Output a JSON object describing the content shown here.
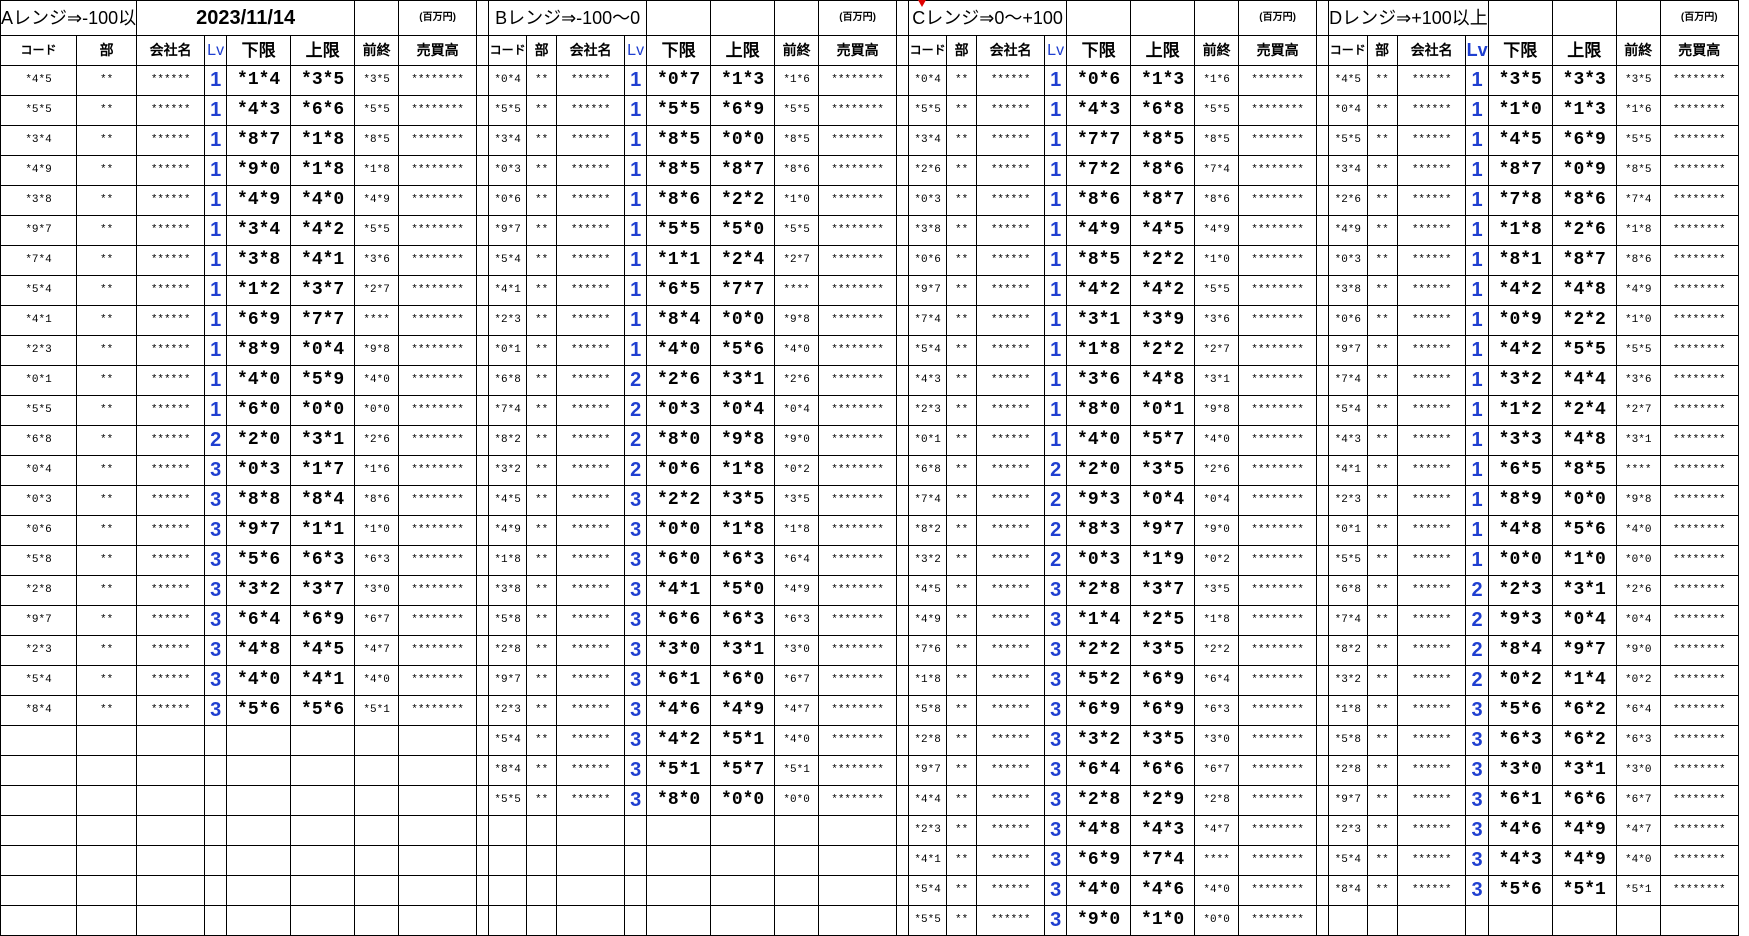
{
  "header": {
    "date": "2023/11/14",
    "unit": "(百万円)"
  },
  "columns": {
    "code": "コード",
    "bu": "部",
    "name": "会社名",
    "lv": "Lv",
    "lo": "下限",
    "hi": "上限",
    "prev": "前終",
    "sales": "売買高"
  },
  "blocks": [
    {
      "title": "Aレンジ⇒-100以",
      "rows": [
        [
          "*4*5",
          "**",
          "******",
          "1",
          "*1*4",
          "*3*5",
          "*3*5",
          "********"
        ],
        [
          "*5*5",
          "**",
          "******",
          "1",
          "*4*3",
          "*6*6",
          "*5*5",
          "********"
        ],
        [
          "*3*4",
          "**",
          "******",
          "1",
          "*8*7",
          "*1*8",
          "*8*5",
          "********"
        ],
        [
          "*4*9",
          "**",
          "******",
          "1",
          "*9*0",
          "*1*8",
          "*1*8",
          "********"
        ],
        [
          "*3*8",
          "**",
          "******",
          "1",
          "*4*9",
          "*4*0",
          "*4*9",
          "********"
        ],
        [
          "*9*7",
          "**",
          "******",
          "1",
          "*3*4",
          "*4*2",
          "*5*5",
          "********"
        ],
        [
          "*7*4",
          "**",
          "******",
          "1",
          "*3*8",
          "*4*1",
          "*3*6",
          "********"
        ],
        [
          "*5*4",
          "**",
          "******",
          "1",
          "*1*2",
          "*3*7",
          "*2*7",
          "********"
        ],
        [
          "*4*1",
          "**",
          "******",
          "1",
          "*6*9",
          "*7*7",
          "****",
          "********"
        ],
        [
          "*2*3",
          "**",
          "******",
          "1",
          "*8*9",
          "*0*4",
          "*9*8",
          "********"
        ],
        [
          "*0*1",
          "**",
          "******",
          "1",
          "*4*0",
          "*5*9",
          "*4*0",
          "********"
        ],
        [
          "*5*5",
          "**",
          "******",
          "1",
          "*6*0",
          "*0*0",
          "*0*0",
          "********"
        ],
        [
          "*6*8",
          "**",
          "******",
          "2",
          "*2*0",
          "*3*1",
          "*2*6",
          "********"
        ],
        [
          "*0*4",
          "**",
          "******",
          "3",
          "*0*3",
          "*1*7",
          "*1*6",
          "********"
        ],
        [
          "*0*3",
          "**",
          "******",
          "3",
          "*8*8",
          "*8*4",
          "*8*6",
          "********"
        ],
        [
          "*0*6",
          "**",
          "******",
          "3",
          "*9*7",
          "*1*1",
          "*1*0",
          "********"
        ],
        [
          "*5*8",
          "**",
          "******",
          "3",
          "*5*6",
          "*6*3",
          "*6*3",
          "********"
        ],
        [
          "*2*8",
          "**",
          "******",
          "3",
          "*3*2",
          "*3*7",
          "*3*0",
          "********"
        ],
        [
          "*9*7",
          "**",
          "******",
          "3",
          "*6*4",
          "*6*9",
          "*6*7",
          "********"
        ],
        [
          "*2*3",
          "**",
          "******",
          "3",
          "*4*8",
          "*4*5",
          "*4*7",
          "********"
        ],
        [
          "*5*4",
          "**",
          "******",
          "3",
          "*4*0",
          "*4*1",
          "*4*0",
          "********"
        ],
        [
          "*8*4",
          "**",
          "******",
          "3",
          "*5*6",
          "*5*6",
          "*5*1",
          "********"
        ]
      ]
    },
    {
      "title": "Bレンジ⇒-100～0",
      "rows": [
        [
          "*0*4",
          "**",
          "******",
          "1",
          "*0*7",
          "*1*3",
          "*1*6",
          "********"
        ],
        [
          "*5*5",
          "**",
          "******",
          "1",
          "*5*5",
          "*6*9",
          "*5*5",
          "********"
        ],
        [
          "*3*4",
          "**",
          "******",
          "1",
          "*8*5",
          "*0*0",
          "*8*5",
          "********"
        ],
        [
          "*0*3",
          "**",
          "******",
          "1",
          "*8*5",
          "*8*7",
          "*8*6",
          "********"
        ],
        [
          "*0*6",
          "**",
          "******",
          "1",
          "*8*6",
          "*2*2",
          "*1*0",
          "********"
        ],
        [
          "*9*7",
          "**",
          "******",
          "1",
          "*5*5",
          "*5*0",
          "*5*5",
          "********"
        ],
        [
          "*5*4",
          "**",
          "******",
          "1",
          "*1*1",
          "*2*4",
          "*2*7",
          "********"
        ],
        [
          "*4*1",
          "**",
          "******",
          "1",
          "*6*5",
          "*7*7",
          "****",
          "********"
        ],
        [
          "*2*3",
          "**",
          "******",
          "1",
          "*8*4",
          "*0*0",
          "*9*8",
          "********"
        ],
        [
          "*0*1",
          "**",
          "******",
          "1",
          "*4*0",
          "*5*6",
          "*4*0",
          "********"
        ],
        [
          "*6*8",
          "**",
          "******",
          "2",
          "*2*6",
          "*3*1",
          "*2*6",
          "********"
        ],
        [
          "*7*4",
          "**",
          "******",
          "2",
          "*0*3",
          "*0*4",
          "*0*4",
          "********"
        ],
        [
          "*8*2",
          "**",
          "******",
          "2",
          "*8*0",
          "*9*8",
          "*9*0",
          "********"
        ],
        [
          "*3*2",
          "**",
          "******",
          "2",
          "*0*6",
          "*1*8",
          "*0*2",
          "********"
        ],
        [
          "*4*5",
          "**",
          "******",
          "3",
          "*2*2",
          "*3*5",
          "*3*5",
          "********"
        ],
        [
          "*4*9",
          "**",
          "******",
          "3",
          "*0*0",
          "*1*8",
          "*1*8",
          "********"
        ],
        [
          "*1*8",
          "**",
          "******",
          "3",
          "*6*0",
          "*6*3",
          "*6*4",
          "********"
        ],
        [
          "*3*8",
          "**",
          "******",
          "3",
          "*4*1",
          "*5*0",
          "*4*9",
          "********"
        ],
        [
          "*5*8",
          "**",
          "******",
          "3",
          "*6*6",
          "*6*3",
          "*6*3",
          "********"
        ],
        [
          "*2*8",
          "**",
          "******",
          "3",
          "*3*0",
          "*3*1",
          "*3*0",
          "********"
        ],
        [
          "*9*7",
          "**",
          "******",
          "3",
          "*6*1",
          "*6*0",
          "*6*7",
          "********"
        ],
        [
          "*2*3",
          "**",
          "******",
          "3",
          "*4*6",
          "*4*9",
          "*4*7",
          "********"
        ],
        [
          "*5*4",
          "**",
          "******",
          "3",
          "*4*2",
          "*5*1",
          "*4*0",
          "********"
        ],
        [
          "*8*4",
          "**",
          "******",
          "3",
          "*5*1",
          "*5*7",
          "*5*1",
          "********"
        ],
        [
          "*5*5",
          "**",
          "******",
          "3",
          "*8*0",
          "*0*0",
          "*0*0",
          "********"
        ]
      ]
    },
    {
      "title": "Cレンジ⇒0～+100",
      "rows": [
        [
          "*0*4",
          "**",
          "******",
          "1",
          "*0*6",
          "*1*3",
          "*1*6",
          "********"
        ],
        [
          "*5*5",
          "**",
          "******",
          "1",
          "*4*3",
          "*6*8",
          "*5*5",
          "********"
        ],
        [
          "*3*4",
          "**",
          "******",
          "1",
          "*7*7",
          "*8*5",
          "*8*5",
          "********"
        ],
        [
          "*2*6",
          "**",
          "******",
          "1",
          "*7*2",
          "*8*6",
          "*7*4",
          "********"
        ],
        [
          "*0*3",
          "**",
          "******",
          "1",
          "*8*6",
          "*8*7",
          "*8*6",
          "********"
        ],
        [
          "*3*8",
          "**",
          "******",
          "1",
          "*4*9",
          "*4*5",
          "*4*9",
          "********"
        ],
        [
          "*0*6",
          "**",
          "******",
          "1",
          "*8*5",
          "*2*2",
          "*1*0",
          "********"
        ],
        [
          "*9*7",
          "**",
          "******",
          "1",
          "*4*2",
          "*4*2",
          "*5*5",
          "********"
        ],
        [
          "*7*4",
          "**",
          "******",
          "1",
          "*3*1",
          "*3*9",
          "*3*6",
          "********"
        ],
        [
          "*5*4",
          "**",
          "******",
          "1",
          "*1*8",
          "*2*2",
          "*2*7",
          "********"
        ],
        [
          "*4*3",
          "**",
          "******",
          "1",
          "*3*6",
          "*4*8",
          "*3*1",
          "********"
        ],
        [
          "*2*3",
          "**",
          "******",
          "1",
          "*8*0",
          "*0*1",
          "*9*8",
          "********"
        ],
        [
          "*0*1",
          "**",
          "******",
          "1",
          "*4*0",
          "*5*7",
          "*4*0",
          "********"
        ],
        [
          "*6*8",
          "**",
          "******",
          "2",
          "*2*0",
          "*3*5",
          "*2*6",
          "********"
        ],
        [
          "*7*4",
          "**",
          "******",
          "2",
          "*9*3",
          "*0*4",
          "*0*4",
          "********"
        ],
        [
          "*8*2",
          "**",
          "******",
          "2",
          "*8*3",
          "*9*7",
          "*9*0",
          "********"
        ],
        [
          "*3*2",
          "**",
          "******",
          "2",
          "*0*3",
          "*1*9",
          "*0*2",
          "********"
        ],
        [
          "*4*5",
          "**",
          "******",
          "3",
          "*2*8",
          "*3*7",
          "*3*5",
          "********"
        ],
        [
          "*4*9",
          "**",
          "******",
          "3",
          "*1*4",
          "*2*5",
          "*1*8",
          "********"
        ],
        [
          "*7*6",
          "**",
          "******",
          "3",
          "*2*2",
          "*3*5",
          "*2*2",
          "********"
        ],
        [
          "*1*8",
          "**",
          "******",
          "3",
          "*5*2",
          "*6*9",
          "*6*4",
          "********"
        ],
        [
          "*5*8",
          "**",
          "******",
          "3",
          "*6*9",
          "*6*9",
          "*6*3",
          "********"
        ],
        [
          "*2*8",
          "**",
          "******",
          "3",
          "*3*2",
          "*3*5",
          "*3*0",
          "********"
        ],
        [
          "*9*7",
          "**",
          "******",
          "3",
          "*6*4",
          "*6*6",
          "*6*7",
          "********"
        ],
        [
          "*4*4",
          "**",
          "******",
          "3",
          "*2*8",
          "*2*9",
          "*2*8",
          "********"
        ],
        [
          "*2*3",
          "**",
          "******",
          "3",
          "*4*8",
          "*4*3",
          "*4*7",
          "********"
        ],
        [
          "*4*1",
          "**",
          "******",
          "3",
          "*6*9",
          "*7*4",
          "****",
          "********"
        ],
        [
          "*5*4",
          "**",
          "******",
          "3",
          "*4*0",
          "*4*6",
          "*4*0",
          "********"
        ],
        [
          "*5*5",
          "**",
          "******",
          "3",
          "*9*0",
          "*1*0",
          "*0*0",
          "********"
        ]
      ]
    },
    {
      "title": "Dレンジ⇒+100以上",
      "rows": [
        [
          "*4*5",
          "**",
          "******",
          "1",
          "*3*5",
          "*3*3",
          "*3*5",
          "********"
        ],
        [
          "*0*4",
          "**",
          "******",
          "1",
          "*1*0",
          "*1*3",
          "*1*6",
          "********"
        ],
        [
          "*5*5",
          "**",
          "******",
          "1",
          "*4*5",
          "*6*9",
          "*5*5",
          "********"
        ],
        [
          "*3*4",
          "**",
          "******",
          "1",
          "*8*7",
          "*0*9",
          "*8*5",
          "********"
        ],
        [
          "*2*6",
          "**",
          "******",
          "1",
          "*7*8",
          "*8*6",
          "*7*4",
          "********"
        ],
        [
          "*4*9",
          "**",
          "******",
          "1",
          "*1*8",
          "*2*6",
          "*1*8",
          "********"
        ],
        [
          "*0*3",
          "**",
          "******",
          "1",
          "*8*1",
          "*8*7",
          "*8*6",
          "********"
        ],
        [
          "*3*8",
          "**",
          "******",
          "1",
          "*4*2",
          "*4*8",
          "*4*9",
          "********"
        ],
        [
          "*0*6",
          "**",
          "******",
          "1",
          "*0*9",
          "*2*2",
          "*1*0",
          "********"
        ],
        [
          "*9*7",
          "**",
          "******",
          "1",
          "*4*2",
          "*5*5",
          "*5*5",
          "********"
        ],
        [
          "*7*4",
          "**",
          "******",
          "1",
          "*3*2",
          "*4*4",
          "*3*6",
          "********"
        ],
        [
          "*5*4",
          "**",
          "******",
          "1",
          "*1*2",
          "*2*4",
          "*2*7",
          "********"
        ],
        [
          "*4*3",
          "**",
          "******",
          "1",
          "*3*3",
          "*4*8",
          "*3*1",
          "********"
        ],
        [
          "*4*1",
          "**",
          "******",
          "1",
          "*6*5",
          "*8*5",
          "****",
          "********"
        ],
        [
          "*2*3",
          "**",
          "******",
          "1",
          "*8*9",
          "*0*0",
          "*9*8",
          "********"
        ],
        [
          "*0*1",
          "**",
          "******",
          "1",
          "*4*8",
          "*5*6",
          "*4*0",
          "********"
        ],
        [
          "*5*5",
          "**",
          "******",
          "1",
          "*0*0",
          "*1*0",
          "*0*0",
          "********"
        ],
        [
          "*6*8",
          "**",
          "******",
          "2",
          "*2*3",
          "*3*1",
          "*2*6",
          "********"
        ],
        [
          "*7*4",
          "**",
          "******",
          "2",
          "*9*3",
          "*0*4",
          "*0*4",
          "********"
        ],
        [
          "*8*2",
          "**",
          "******",
          "2",
          "*8*4",
          "*9*7",
          "*9*0",
          "********"
        ],
        [
          "*3*2",
          "**",
          "******",
          "2",
          "*0*2",
          "*1*4",
          "*0*2",
          "********"
        ],
        [
          "*1*8",
          "**",
          "******",
          "3",
          "*5*6",
          "*6*2",
          "*6*4",
          "********"
        ],
        [
          "*5*8",
          "**",
          "******",
          "3",
          "*6*3",
          "*6*2",
          "*6*3",
          "********"
        ],
        [
          "*2*8",
          "**",
          "******",
          "3",
          "*3*0",
          "*3*1",
          "*3*0",
          "********"
        ],
        [
          "*9*7",
          "**",
          "******",
          "3",
          "*6*1",
          "*6*6",
          "*6*7",
          "********"
        ],
        [
          "*2*3",
          "**",
          "******",
          "3",
          "*4*6",
          "*4*9",
          "*4*7",
          "********"
        ],
        [
          "*5*4",
          "**",
          "******",
          "3",
          "*4*3",
          "*4*9",
          "*4*0",
          "********"
        ],
        [
          "*8*4",
          "**",
          "******",
          "3",
          "*5*6",
          "*5*1",
          "*5*1",
          "********"
        ]
      ]
    }
  ]
}
